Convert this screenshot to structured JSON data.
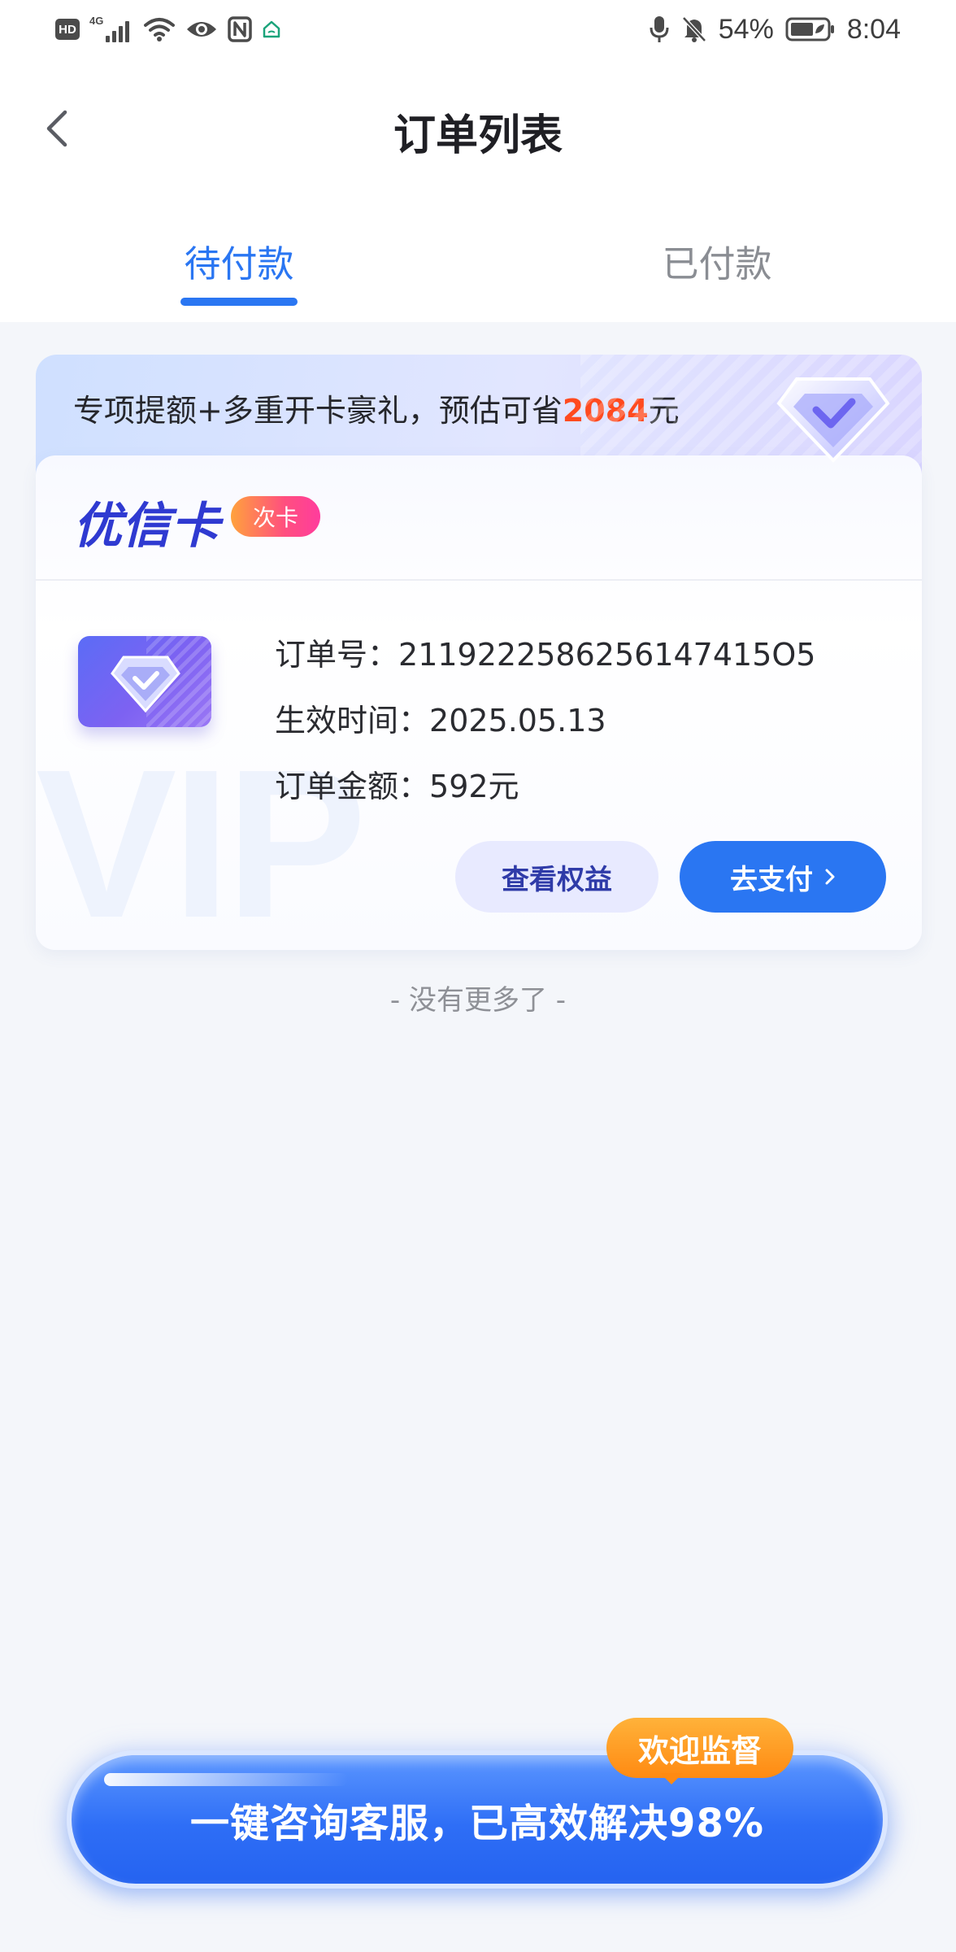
{
  "status_bar": {
    "hd": "HD",
    "network": "4G",
    "battery": "54%",
    "time": "8:04",
    "icons": [
      "hd-icon",
      "signal-icon",
      "wifi-icon",
      "eye-icon",
      "nfc-icon",
      "home-icon",
      "mic-icon",
      "bell-off-icon",
      "battery-icon"
    ]
  },
  "header": {
    "title": "订单列表",
    "back_icon": "chevron-left-icon"
  },
  "tabs": {
    "unpaid": "待付款",
    "paid": "已付款",
    "active": "unpaid"
  },
  "order": {
    "promo_prefix": "专项提额+多重开卡豪礼，预估可省",
    "promo_amount": "2084",
    "promo_suffix": "元",
    "card_name": "优信卡",
    "card_badge": "次卡",
    "watermark": "VIP",
    "order_no_label": "订单号：",
    "order_no": "2119222586256147415O5",
    "effective_label": "生效时间：",
    "effective_date": "2025.05.13",
    "amount_label": "订单金额：",
    "amount": "592元",
    "benefits_button": "查看权益",
    "pay_button": "去支付"
  },
  "list_footer": "- 没有更多了 -",
  "service": {
    "button_label": "一键咨询客服，已高效解决98%",
    "tag": "欢迎监督"
  },
  "colors": {
    "accent": "#2a76f2",
    "promo_amount": "#ff4a1f",
    "card_name": "#2f3ad1",
    "welcome_tag": "#ff8a12",
    "background": "#f4f6fa"
  }
}
